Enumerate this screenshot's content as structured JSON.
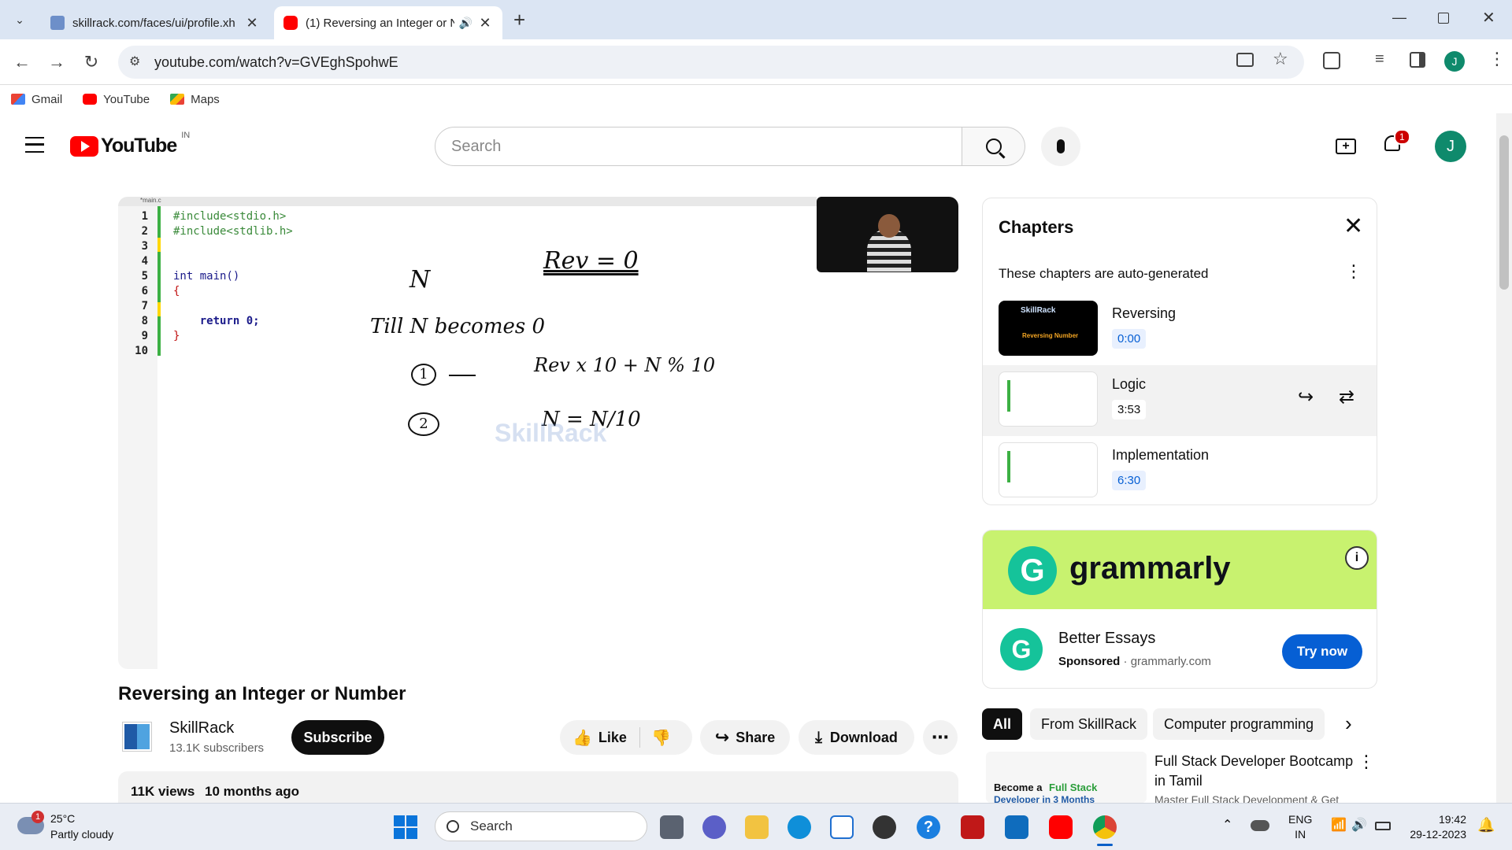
{
  "browser": {
    "tabs": [
      {
        "title": "skillrack.com/faces/ui/profile.xh",
        "active": false
      },
      {
        "title": "(1) Reversing an Integer or N",
        "active": true
      }
    ],
    "url": "youtube.com/watch?v=GVEghSpohwE",
    "bookmarks": [
      "Gmail",
      "YouTube",
      "Maps"
    ],
    "profile_initial": "J"
  },
  "yt_header": {
    "logo_text": "YouTube",
    "country": "IN",
    "search_placeholder": "Search",
    "notification_count": "1",
    "avatar_initial": "J"
  },
  "video_frame": {
    "editor_tab": "*main.c",
    "line_numbers": [
      "1",
      "2",
      "3",
      "4",
      "5",
      "6",
      "7",
      "8",
      "9",
      "10"
    ],
    "code_lines": [
      {
        "line": 1,
        "text": "#include<stdio.h>"
      },
      {
        "line": 2,
        "text": "#include<stdlib.h>"
      },
      {
        "line": 5,
        "text": "int main()"
      },
      {
        "line": 6,
        "text": "{"
      },
      {
        "line": 8,
        "text": "    return 0;"
      },
      {
        "line": 9,
        "text": "}"
      }
    ],
    "handwriting": {
      "n_label": "N",
      "rev_init": "Rev = 0",
      "till": "Till N becomes 0",
      "step1_num": "1",
      "step1": "Rev x 10 + N % 10",
      "step2_num": "2",
      "step2": "N = N/10"
    },
    "watermark": "SkillRack"
  },
  "video": {
    "title": "Reversing an Integer or Number",
    "channel": "SkillRack",
    "subscribers": "13.1K subscribers",
    "subscribe_label": "Subscribe",
    "like_label": "Like",
    "share_label": "Share",
    "download_label": "Download",
    "views": "11K views",
    "age": "10 months ago"
  },
  "chapters": {
    "title": "Chapters",
    "subtitle": "These chapters are auto-generated",
    "items": [
      {
        "name": "Reversing",
        "time": "0:00",
        "thumb_brand": "SkillRack",
        "thumb_caption": "Reversing Number"
      },
      {
        "name": "Logic",
        "time": "3:53"
      },
      {
        "name": "Implementation",
        "time": "6:30"
      }
    ]
  },
  "ad": {
    "brand": "grammarly",
    "headline": "Better Essays",
    "sponsored": "Sponsored",
    "domain": "grammarly.com",
    "cta": "Try now"
  },
  "filters": [
    "All",
    "From SkillRack",
    "Computer programming"
  ],
  "recommendation": {
    "title_line1": "Full Stack Developer Bootcamp",
    "title_line2": "in Tamil",
    "subtitle": "Master Full Stack Development & Get",
    "thumb_text1": "Become a",
    "thumb_text2": "Full Stack",
    "thumb_text3": "Developer in 3 Months"
  },
  "taskbar": {
    "temp": "25°C",
    "weather": "Partly cloudy",
    "weather_badge": "1",
    "search_placeholder": "Search",
    "lang1": "ENG",
    "lang2": "IN",
    "time": "19:42",
    "date": "29-12-2023"
  },
  "colors": {
    "yt_red": "#ff0000",
    "accent_blue": "#065fd4",
    "chrome_tabbar": "#dbe5f3",
    "avatar_green": "#0f8a6c",
    "grammarly_green": "#15c39a"
  }
}
